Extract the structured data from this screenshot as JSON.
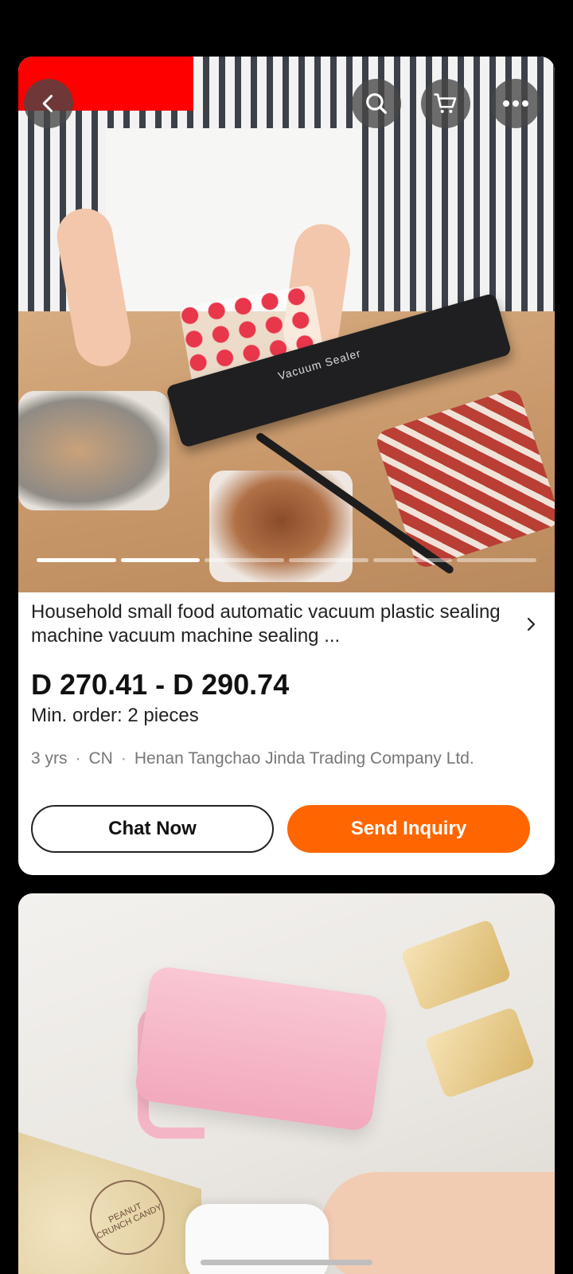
{
  "product": {
    "title": "Household small food automatic vacuum plastic sealing machine vacuum machine sealing ...",
    "price": "D 270.41 - D 290.74",
    "min_order": "Min. order: 2 pieces",
    "supplier": {
      "years": "3 yrs",
      "country": "CN",
      "name": "Henan Tangchao Jinda Trading Company Ltd."
    },
    "image_text": "Vacuum Sealer",
    "carousel": {
      "total": 6,
      "active": 2
    }
  },
  "actions": {
    "chat_label": "Chat Now",
    "inquiry_label": "Send Inquiry"
  },
  "next_product": {
    "image_text": "PEANUT CRUNCH CANDY"
  },
  "header_icons": [
    "back-icon",
    "search-icon",
    "cart-icon",
    "more-icon"
  ],
  "colors": {
    "accent": "#ff6600",
    "background": "#000000",
    "badge": "#ff0000"
  }
}
